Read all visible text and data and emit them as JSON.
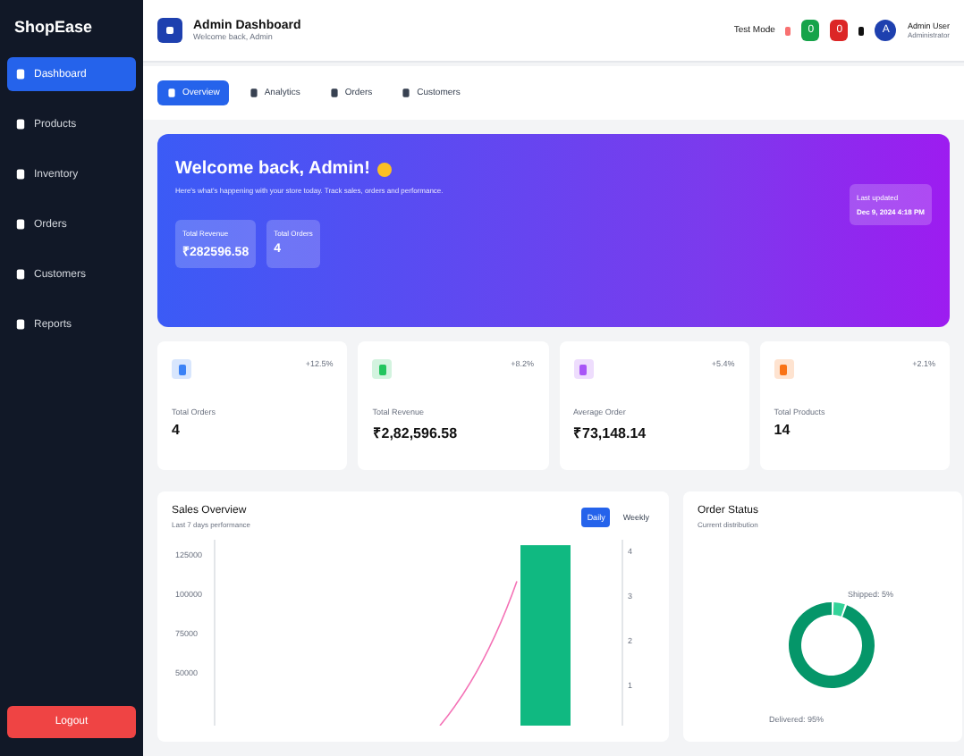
{
  "sidebar": {
    "brand": "ShopEase",
    "items": [
      {
        "label": "Dashboard",
        "selected": true
      },
      {
        "label": "Products",
        "selected": false
      },
      {
        "label": "Inventory",
        "selected": false
      },
      {
        "label": "Orders",
        "selected": false
      },
      {
        "label": "Customers",
        "selected": false
      },
      {
        "label": "Reports",
        "selected": false
      }
    ],
    "logout": "Logout"
  },
  "header": {
    "title": "Admin Dashboard",
    "subtitle": "Welcome back, Admin",
    "mode": "Test Mode",
    "badges": [
      {
        "label": "0",
        "color": "#16a34a"
      },
      {
        "label": "0",
        "color": "#dc2626"
      }
    ],
    "user_name": "Admin User",
    "user_role": "Administrator",
    "avatar": "A"
  },
  "tabs": [
    {
      "label": "Overview",
      "selected": true
    },
    {
      "label": "Analytics",
      "selected": false
    },
    {
      "label": "Orders",
      "selected": false
    },
    {
      "label": "Customers",
      "selected": false
    }
  ],
  "hero": {
    "title": "Welcome back, Admin!",
    "text": "Here's what's happening with your store today. Track sales, orders and performance.",
    "stats": [
      {
        "label": "Total Revenue",
        "value": "₹282596.58"
      },
      {
        "label": "Total Orders",
        "value": "4"
      }
    ],
    "updated_label": "Last updated",
    "updated_value": "Dec 9, 2024 4:18 PM"
  },
  "stats": [
    {
      "label": "Total Orders",
      "value": "4",
      "change": "+12.5%",
      "color": "#3b82f6"
    },
    {
      "label": "Total Revenue",
      "value": "₹2,82,596.58",
      "change": "+8.2%",
      "color": "#22c55e"
    },
    {
      "label": "Average Order",
      "value": "₹73,148.14",
      "change": "+5.4%",
      "color": "#a855f7"
    },
    {
      "label": "Total Products",
      "value": "14",
      "change": "+2.1%",
      "color": "#f97316"
    }
  ],
  "sales": {
    "title": "Sales Overview",
    "subtitle": "Last 7 days performance",
    "toggles": [
      {
        "label": "Daily",
        "selected": true
      },
      {
        "label": "Weekly",
        "selected": false
      }
    ],
    "right_ticks": [
      "4",
      "3",
      "2",
      "1"
    ],
    "left_ticks": [
      "125000",
      "100000",
      "75000",
      "50000"
    ]
  },
  "status": {
    "title": "Order Status",
    "subtitle": "Current distribution",
    "chart_data": {
      "type": "donut",
      "values": [
        5,
        95
      ],
      "value_labels": [
        "Shipped: 5%",
        "Delivered: 95%"
      ]
    }
  }
}
